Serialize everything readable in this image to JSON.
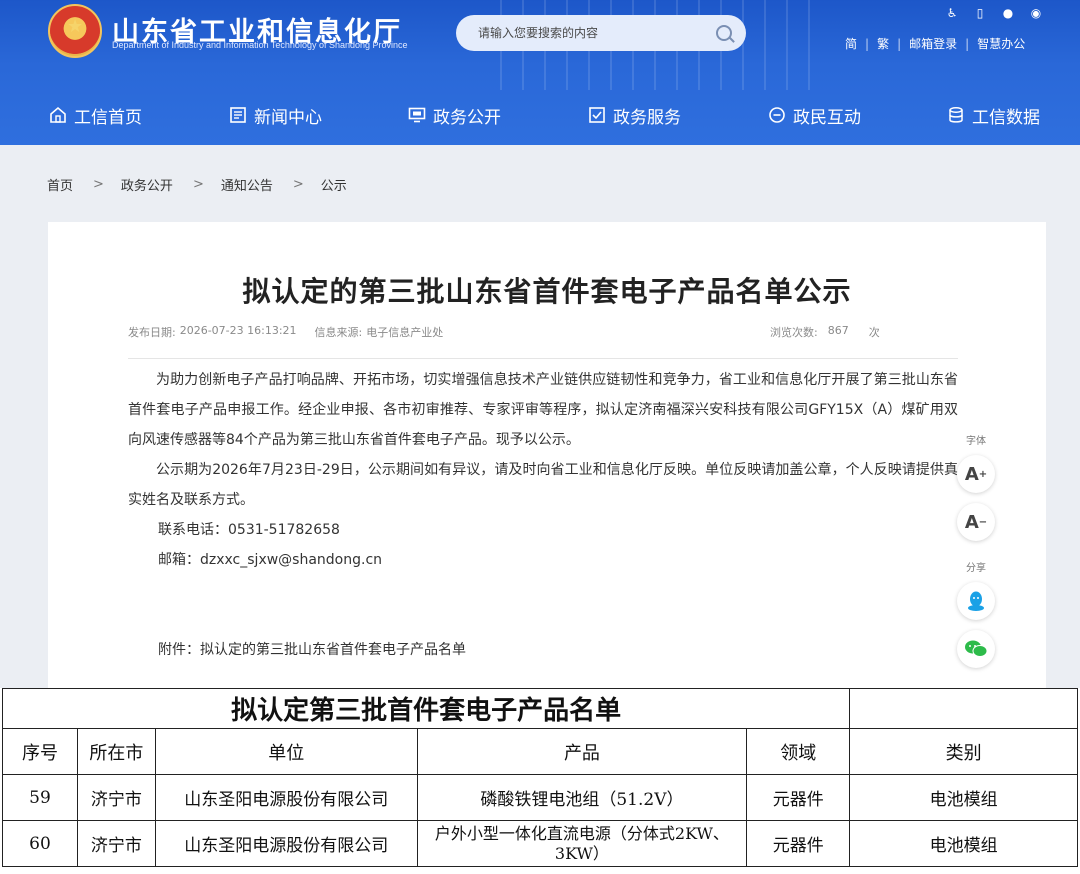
{
  "header": {
    "title": "山东省工业和信息化厅",
    "subtitle": "Department of Industry and Information Technology of Shandong Province",
    "search_placeholder": "请输入您要搜索的内容",
    "links": [
      "简",
      "繁",
      "邮箱登录",
      "智慧办公"
    ],
    "icons": [
      "accessibility-icon",
      "mobile-icon",
      "wechat-icon",
      "weibo-icon"
    ]
  },
  "nav": [
    {
      "label": "工信首页",
      "icon": "home-icon"
    },
    {
      "label": "新闻中心",
      "icon": "news-icon"
    },
    {
      "label": "政务公开",
      "icon": "monitor-icon"
    },
    {
      "label": "政务服务",
      "icon": "service-icon"
    },
    {
      "label": "政民互动",
      "icon": "chat-icon"
    },
    {
      "label": "工信数据",
      "icon": "database-icon"
    }
  ],
  "breadcrumb": [
    "首页",
    "政务公开",
    "通知公告",
    "公示"
  ],
  "breadcrumb_sep": ">",
  "article": {
    "title": "拟认定的第三批山东省首件套电子产品名单公示",
    "publish_label": "发布日期:",
    "publish_date": "2026-07-23 16:13:21",
    "source_label": "信息来源:",
    "source": "电子信息产业处",
    "views_label": "浏览次数:",
    "views": "867",
    "views_unit": "次",
    "para1": "为助力创新电子产品打响品牌、开拓市场，切实增强信息技术产业链供应链韧性和竞争力，省工业和信息化厅开展了第三批山东省首件套电子产品申报工作。经企业申报、各市初审推荐、专家评审等程序，拟认定济南福深兴安科技有限公司GFY15X（A）煤矿用双向风速传感器等84个产品为第三批山东省首件套电子产品。现予以公示。",
    "para2": "公示期为2026年7月23日-29日，公示期间如有异议，请及时向省工业和信息化厅反映。单位反映请加盖公章，个人反映请提供真实姓名及联系方式。",
    "phone": "联系电话：0531-51782658",
    "email": "邮箱：dzxxc_sjxw@shandong.cn",
    "attachment": "附件：拟认定的第三批山东省首件套电子产品名单"
  },
  "tools": {
    "font_label": "字体",
    "font_up": "A",
    "font_up_sign": "+",
    "font_down": "A",
    "font_down_sign": "−",
    "share_label": "分享"
  },
  "table": {
    "title": "拟认定第三批首件套电子产品名单",
    "headers": [
      "序号",
      "所在市",
      "单位",
      "产品",
      "领域",
      "类别"
    ],
    "rows": [
      [
        "59",
        "济宁市",
        "山东圣阳电源股份有限公司",
        "磷酸铁锂电池组（51.2V）",
        "元器件",
        "电池模组"
      ],
      [
        "60",
        "济宁市",
        "山东圣阳电源股份有限公司",
        "户外小型一体化直流电源（分体式2KW、3KW）",
        "元器件",
        "电池模组"
      ]
    ]
  },
  "colors": {
    "header_blue": "#2a68d8",
    "page_bg": "#ebeef3"
  }
}
